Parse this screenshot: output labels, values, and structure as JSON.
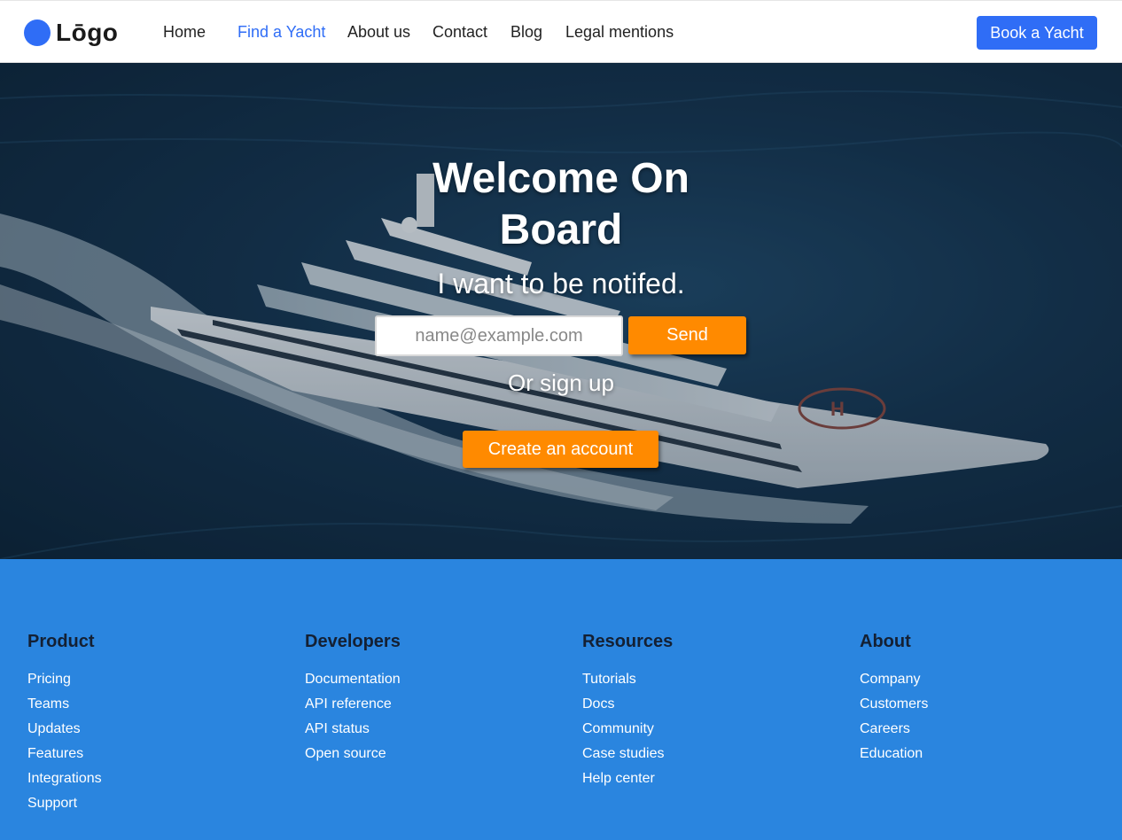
{
  "nav": {
    "logo_text": "Lōgo",
    "links": [
      "Home",
      "Find a Yacht",
      "About us",
      "Contact",
      "Blog",
      "Legal mentions"
    ],
    "active_link": "Find a Yacht",
    "book_button": "Book a Yacht"
  },
  "hero": {
    "title_line1": "Welcome On",
    "title_line2": "Board",
    "subtitle": "I want to be notifed.",
    "email_placeholder": "name@example.com",
    "send_button": "Send",
    "or_text": "Or sign up",
    "create_button": "Create an account"
  },
  "footer": {
    "columns": [
      {
        "title": "Product",
        "links": [
          "Pricing",
          "Teams",
          "Updates",
          "Features",
          "Integrations",
          "Support"
        ]
      },
      {
        "title": "Developers",
        "links": [
          "Documentation",
          "API reference",
          "API status",
          "Open source"
        ]
      },
      {
        "title": "Resources",
        "links": [
          "Tutorials",
          "Docs",
          "Community",
          "Case studies",
          "Help center"
        ]
      },
      {
        "title": "About",
        "links": [
          "Company",
          "Customers",
          "Careers",
          "Education"
        ]
      }
    ]
  },
  "colors": {
    "accent": "#2f6df6",
    "orange": "#ff8a00",
    "footer_bg": "#2a85df"
  }
}
